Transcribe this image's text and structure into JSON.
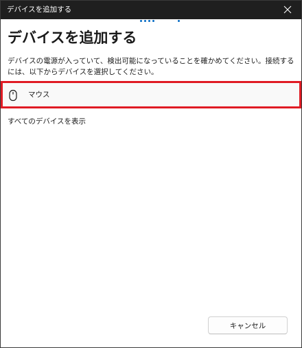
{
  "window": {
    "title": "デバイスを追加する"
  },
  "main": {
    "heading": "デバイスを追加する",
    "description": "デバイスの電源が入っていて、検出可能になっていることを確かめてください。接続するには、以下からデバイスを選択してください。",
    "devices": [
      {
        "label": "マウス",
        "icon": "mouse-icon"
      }
    ],
    "show_all_label": "すべてのデバイスを表示"
  },
  "footer": {
    "cancel_label": "キャンセル"
  },
  "colors": {
    "titlebar": "#1f1f1f",
    "accent": "#0067c0",
    "highlight": "#e01b24"
  }
}
